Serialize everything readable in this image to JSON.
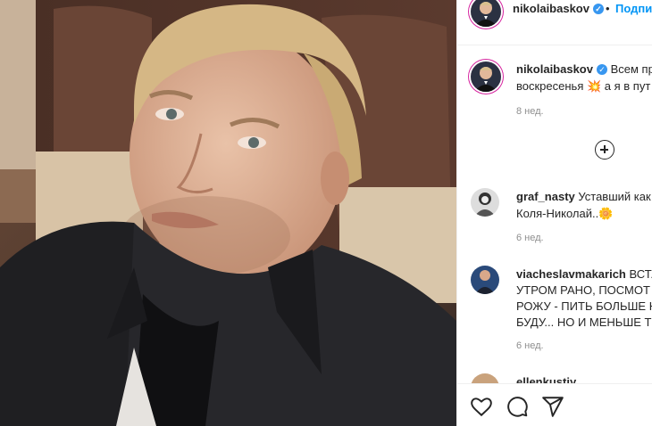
{
  "post": {
    "image_alt_subject": "selfie"
  },
  "header": {
    "username": "nikolaibaskov",
    "follow_label": "Подписаться",
    "separator": "•"
  },
  "caption": {
    "username": "nikolaibaskov",
    "line1": "Всем пр",
    "line2": "воскресенья 💥 а я в пут",
    "age": "8 нед."
  },
  "comments": [
    {
      "username": "graf_nasty",
      "line1": "Уставший как",
      "line2": "Коля-Николай..🌼",
      "age": "6 нед."
    },
    {
      "username": "viacheslavmakarich",
      "line1": "ВСТА",
      "line2": "УТРОМ РАНО, ПОСМОТ",
      "line3": "РОЖУ - ПИТЬ БОЛЬШЕ Н",
      "line4": "БУДУ... НО И МЕНЬШЕ Т",
      "age": "6 нед."
    },
    {
      "username": "ellenkustiy"
    }
  ],
  "icons": {
    "like": "heart-icon",
    "comment": "comment-icon",
    "share": "share-icon",
    "more_comments": "plus-circle-icon",
    "verified": "verified-badge-icon"
  },
  "colors": {
    "accent": "#0095f6",
    "verified": "#3897f0",
    "muted": "#8e8e8e"
  }
}
